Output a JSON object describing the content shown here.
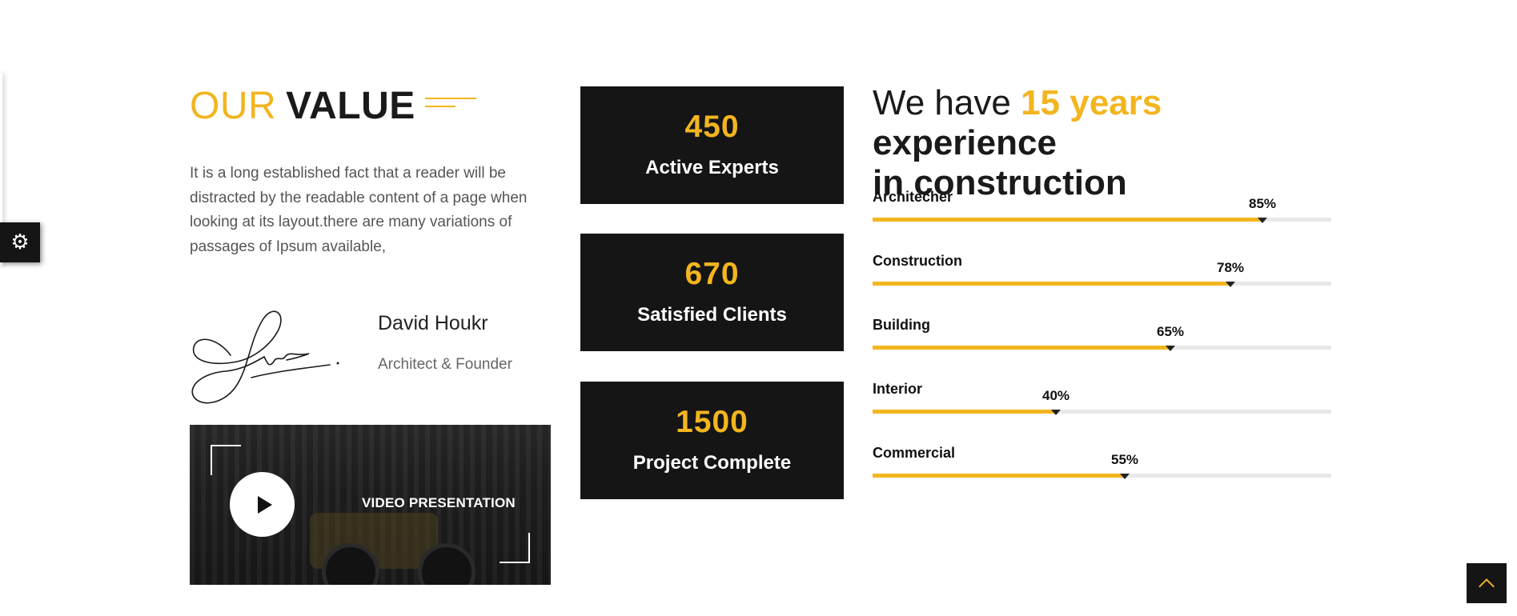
{
  "settings": {
    "icon": "gear-icon"
  },
  "value_section": {
    "title_light": "OUR",
    "title_bold": "VALUE",
    "description": "It is a long established fact that a reader will be distracted by the readable content of a page when looking at its layout.there are many variations of passages of Ipsum available,",
    "person": {
      "name": "David Houkr",
      "role": "Architect & Founder"
    },
    "video": {
      "label": "VIDEO PRESENTATION",
      "icon": "play-icon"
    }
  },
  "stats": [
    {
      "number": "450",
      "label": "Active Experts"
    },
    {
      "number": "670",
      "label": "Satisfied Clients"
    },
    {
      "number": "1500",
      "label": "Project Complete"
    }
  ],
  "experience": {
    "prefix": "We have",
    "highlight": "15 years",
    "suffix_line1": "experience",
    "suffix_line2": "in construction"
  },
  "skills": [
    {
      "name": "Architecher",
      "percent_label": "85%",
      "value": 0.85
    },
    {
      "name": "Construction",
      "percent_label": "78%",
      "value": 0.78
    },
    {
      "name": "Building",
      "percent_label": "65%",
      "value": 0.65
    },
    {
      "name": "Interior",
      "percent_label": "40%",
      "value": 0.4
    },
    {
      "name": "Commercial",
      "percent_label": "55%",
      "value": 0.55
    }
  ],
  "scroll_top": {
    "icon": "chevron-up-icon"
  },
  "colors": {
    "accent": "#f3b51f",
    "dark": "#151515",
    "text": "#1a1a1a",
    "muted": "#555555"
  }
}
